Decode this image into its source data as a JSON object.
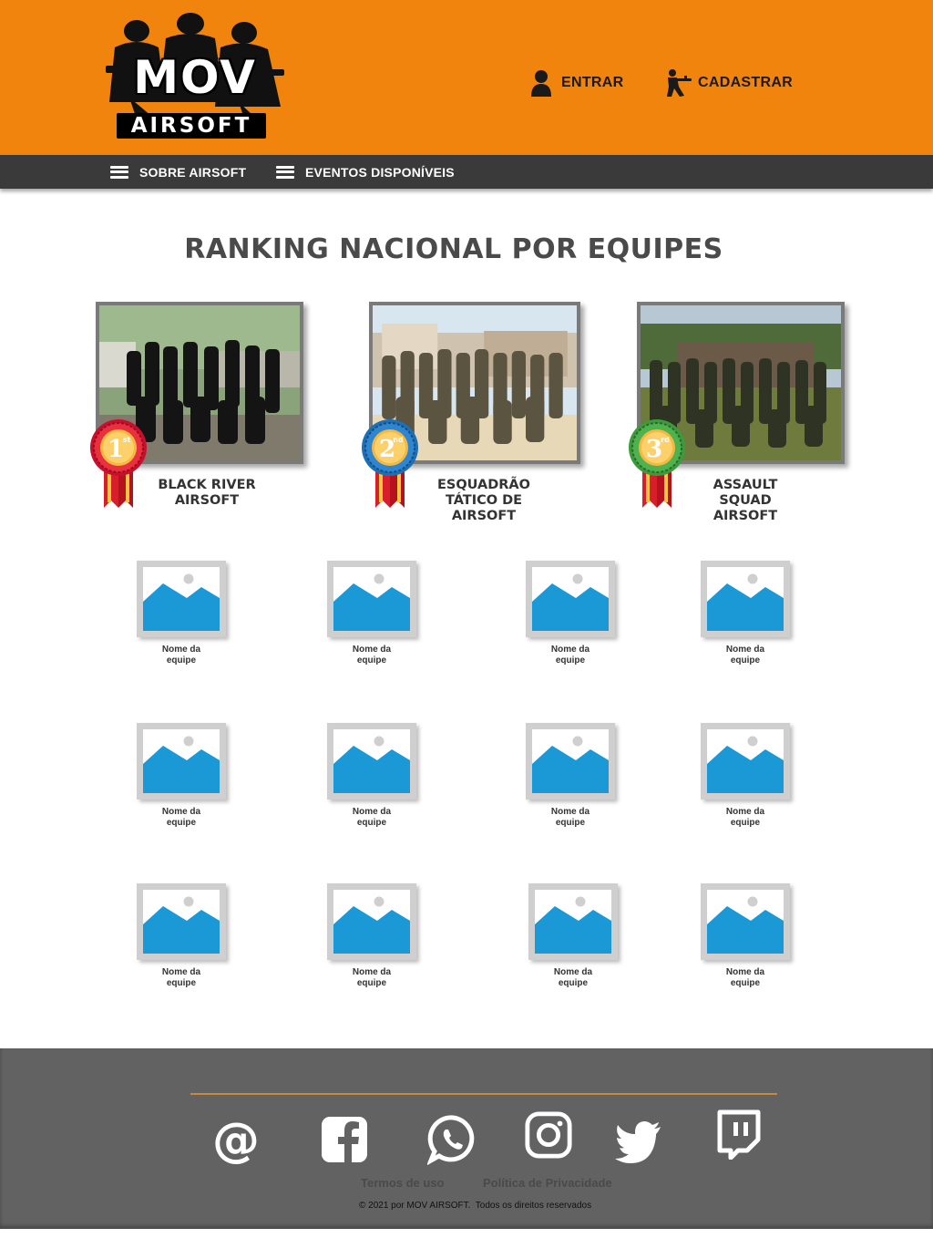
{
  "brand": {
    "logo_line1": "MOV",
    "logo_line2": "AIRSOFT",
    "header_color": "#f0840c",
    "nav_color": "#3a3a3a",
    "footer_color": "#626262"
  },
  "auth": {
    "login_label": "ENTRAR",
    "login_icon": "user-icon",
    "signup_label": "CADASTRAR",
    "signup_icon": "soldier-icon"
  },
  "nav": {
    "items": [
      {
        "label": "SOBRE AIRSOFT",
        "icon": "menu-icon"
      },
      {
        "label": "EVENTOS DISPONÍVEIS",
        "icon": "menu-icon"
      }
    ]
  },
  "main": {
    "title": "RANKING NACIONAL POR EQUIPES",
    "podium": [
      {
        "place": "1",
        "suffix": "st",
        "team": "BLACK RIVER AIRSOFT",
        "medal_color": "#c8102e"
      },
      {
        "place": "2",
        "suffix": "nd",
        "team": "ESQUADRÃO TÁTICO DE AIRSOFT",
        "medal_color": "#1f6fb5"
      },
      {
        "place": "3",
        "suffix": "rd",
        "team": "ASSAULT SQUAD AIRSOFT",
        "medal_color": "#3d9a3d"
      }
    ],
    "placeholder_name": "Nome da equipe",
    "placeholder_name_line1": "Nome da",
    "placeholder_name_line2": "equipe",
    "placeholder_icon": "image-placeholder-icon"
  },
  "footer": {
    "social": [
      "email-icon",
      "facebook-icon",
      "whatsapp-icon",
      "instagram-icon",
      "twitter-icon",
      "twitch-icon"
    ],
    "terms_label": "Termos de uso",
    "privacy_label": "Política de Privacidade",
    "copyright": "© 2021 por MOV AIRSOFT.  Todos os direitos reservados"
  }
}
